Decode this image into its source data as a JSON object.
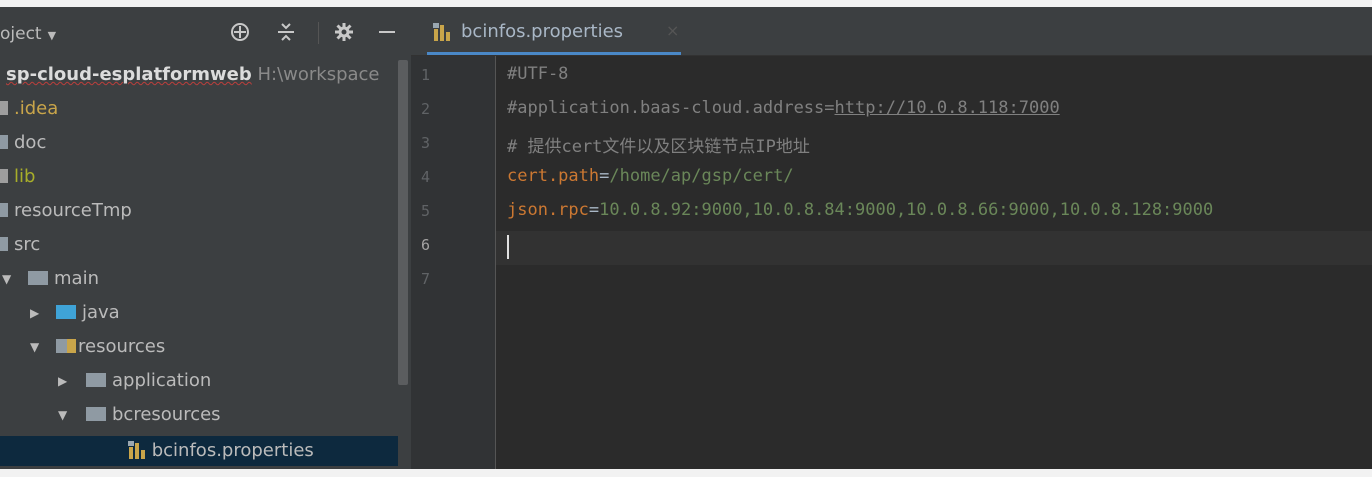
{
  "project_panel": {
    "title": "oject",
    "tree": [
      {
        "id": "root",
        "label": "sp-cloud-esplatformweb",
        "hint": "H:\\workspace"
      },
      {
        "id": "idea",
        "label": ".idea"
      },
      {
        "id": "doc",
        "label": "doc"
      },
      {
        "id": "lib",
        "label": "lib"
      },
      {
        "id": "resourcetmp",
        "label": "resourceTmp"
      },
      {
        "id": "src",
        "label": "src"
      },
      {
        "id": "main",
        "label": "main"
      },
      {
        "id": "java",
        "label": "java"
      },
      {
        "id": "resources",
        "label": "resources"
      },
      {
        "id": "application",
        "label": "application"
      },
      {
        "id": "bcresources",
        "label": "bcresources"
      },
      {
        "id": "bcinfos",
        "label": "bcinfos.properties"
      }
    ]
  },
  "editor": {
    "tab_label": "bcinfos.properties",
    "line_numbers": [
      "1",
      "2",
      "3",
      "4",
      "5",
      "6",
      "7"
    ],
    "current_line": "6",
    "lines": {
      "l1": "#UTF-8",
      "l2_prefix": "#application.baas-cloud.address=",
      "l2_link": "http://10.0.8.118:7000",
      "l3": "# 提供cert文件以及区块链节点IP地址",
      "l4_key": "cert.path",
      "l4_eq": "=",
      "l4_val": "/home/ap/gsp/cert/",
      "l5_key": "json.rpc",
      "l5_eq": "=",
      "l5_val": "10.0.8.92:9000,10.0.8.84:9000,10.0.8.66:9000,10.0.8.128:9000"
    }
  },
  "colors": {
    "panel_bg": "#3c3f41",
    "editor_bg": "#2b2b2b",
    "selection": "#0d293e",
    "keyword": "#cc7832",
    "string": "#6a8759",
    "comment": "#808080",
    "tab_underline": "#4a88c7"
  }
}
